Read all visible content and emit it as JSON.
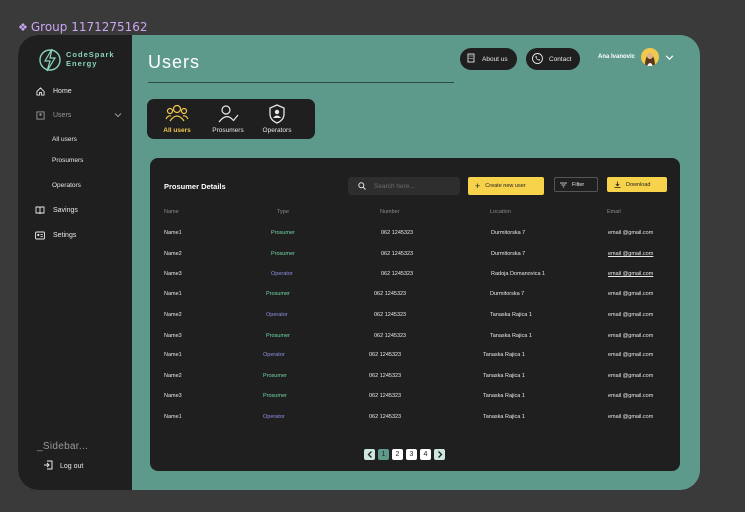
{
  "canvas_label": "Group 1171275162",
  "brand": {
    "name_line1": "CodeSpark",
    "name_line2": "Energy"
  },
  "sidebar": {
    "items": [
      {
        "label": "Home"
      },
      {
        "label": "Users"
      },
      {
        "label": "Savings"
      },
      {
        "label": "Setings"
      }
    ],
    "sub_items": [
      {
        "label": "All users"
      },
      {
        "label": "Prosumers"
      },
      {
        "label": "Operators"
      }
    ],
    "section_title": "_Sidebar...",
    "logout": "Log out"
  },
  "header": {
    "title": "Users",
    "about": "About us",
    "contact": "Contact",
    "user_name": "Ana Ivanovic"
  },
  "tabs": [
    {
      "label": "All users",
      "icon": "users-group-icon"
    },
    {
      "label": "Prosumers",
      "icon": "user-check-icon"
    },
    {
      "label": "Operators",
      "icon": "user-shield-icon"
    }
  ],
  "card": {
    "title": "Prosumer Details",
    "search_placeholder": "Search here...",
    "create_label": "Create new user",
    "filter_label": "Filter",
    "download_label": "Download",
    "columns": [
      "Name",
      "Type",
      "Number",
      "Location",
      "Email"
    ],
    "rows": [
      {
        "name": "Name1",
        "type": "Prosumer",
        "number": "062 1245323",
        "location": "Durmitorska 7",
        "email": "email @gmail.com"
      },
      {
        "name": "Name2",
        "type": "Prosumer",
        "number": "062 1245323",
        "location": "Durmitorska 7",
        "email": "email @gmail.com"
      },
      {
        "name": "Name3",
        "type": "Operator",
        "number": "062 1245323",
        "location": "Radoja Domanovica 1",
        "email": "email @gmail.com"
      },
      {
        "name": "Name1",
        "type": "Prosumer",
        "number": "062 1245323",
        "location": "Durmitorska 7",
        "email": "email @gmail.com"
      },
      {
        "name": "Name2",
        "type": "Operator",
        "number": "062 1245323",
        "location": "Tanaska Rajica 1",
        "email": "email @gmail.com"
      },
      {
        "name": "Name3",
        "type": "Prosumer",
        "number": "062 1245323",
        "location": "Tanaska Rajica 1",
        "email": "email @gmail.com"
      },
      {
        "name": "Name1",
        "type": "Operator",
        "number": "062 1245323",
        "location": "Tanaska Rajica 1",
        "email": "email @gmail.com"
      },
      {
        "name": "Name2",
        "type": "Prosumer",
        "number": "062 1245323",
        "location": "Tanaska Rajica 1",
        "email": "email @gmail.com"
      },
      {
        "name": "Name3",
        "type": "Prosumer",
        "number": "062 1245323",
        "location": "Tanaska Rajica 1",
        "email": "email @gmail.com"
      },
      {
        "name": "Name1",
        "type": "Operator",
        "number": "062 1245323",
        "location": "Tanaska Rajica 1",
        "email": "email @gmail.com"
      }
    ],
    "pages": [
      "1",
      "2",
      "3",
      "4"
    ]
  },
  "colors": {
    "frame": "#5e9a8b",
    "panel": "#1f1f1f",
    "accent_yellow": "#f7d24b",
    "prosumer_green": "#6fd6a4",
    "operator_purple": "#8e8ee6"
  }
}
